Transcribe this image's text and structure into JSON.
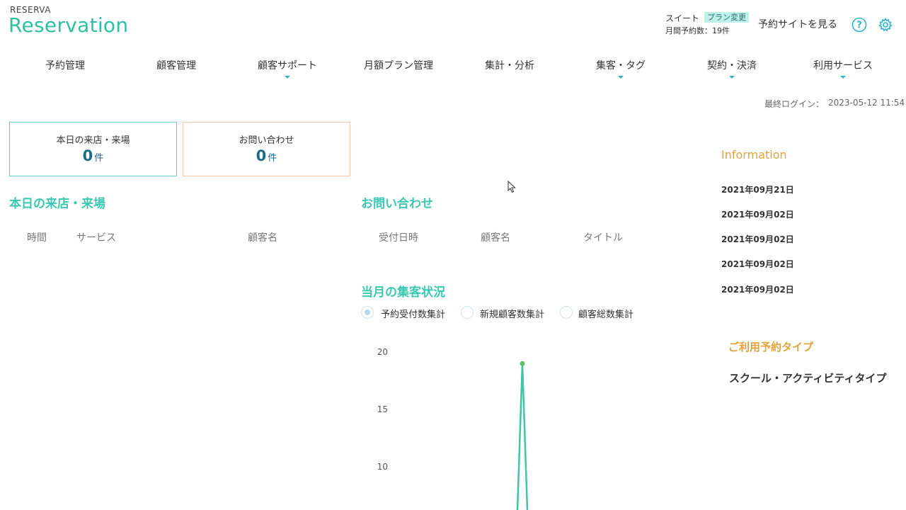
{
  "header": {
    "brand_small": "RESERVA",
    "brand_large": "Reservation",
    "plan_name": "スイート",
    "plan_change": "プラン変更",
    "monthly_count": "月間予約数：19件",
    "site_link": "予約サイトを見る"
  },
  "nav": [
    {
      "label": "予約管理"
    },
    {
      "label": "顧客管理"
    },
    {
      "label": "顧客サポート"
    },
    {
      "label": "月額プラン管理"
    },
    {
      "label": "集計・分析"
    },
    {
      "label": "集客・タグ"
    },
    {
      "label": "契約・決済"
    },
    {
      "label": "利用サービス"
    }
  ],
  "last_login": {
    "label": "最終ログイン：",
    "value": "2023-05-12 11:54"
  },
  "cards": {
    "visits": {
      "title": "本日の来店・来場",
      "count": "0",
      "unit": "件"
    },
    "inquiries": {
      "title": "お問い合わせ",
      "count": "0",
      "unit": "件"
    }
  },
  "visits_section": {
    "title": "本日の来店・来場",
    "columns": [
      "時間",
      "サービス",
      "顧客名"
    ]
  },
  "inquiry_section": {
    "title": "お問い合わせ",
    "columns": [
      "受付日時",
      "顧客名",
      "タイトル"
    ]
  },
  "stats_section": {
    "title": "当月の集客状況",
    "options": [
      "予約受付数集計",
      "新規顧客数集計",
      "顧客総数集計"
    ],
    "selected": 0
  },
  "information": {
    "title": "Information",
    "dates": [
      "2021年09月21日",
      "2021年09月02日",
      "2021年09月02日",
      "2021年09月02日",
      "2021年09月02日"
    ]
  },
  "reservation_type": {
    "title": "ご利用予約タイプ",
    "value": "スクール・アクティビティタイプ"
  },
  "colors": {
    "accent": "#3cc8b0",
    "info_title": "#e2a23b",
    "plan_badge": "#bff0ea"
  },
  "chart_data": {
    "type": "line",
    "y_ticks": [
      "20",
      "15",
      "10"
    ],
    "ylim": [
      0,
      20
    ],
    "series": [
      {
        "peak_value": 19
      }
    ]
  }
}
